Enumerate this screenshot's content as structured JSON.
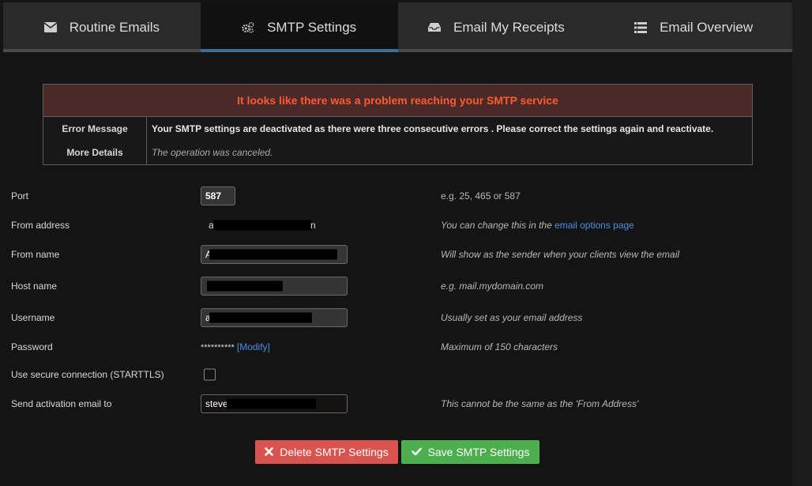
{
  "tabs": [
    {
      "label": "Routine Emails",
      "icon": "envelope-icon"
    },
    {
      "label": "SMTP Settings",
      "icon": "gears-icon"
    },
    {
      "label": "Email My Receipts",
      "icon": "inbox-icon"
    },
    {
      "label": "Email Overview",
      "icon": "list-icon"
    }
  ],
  "error": {
    "title": "It looks like there was a problem reaching your SMTP service",
    "message_label": "Error Message",
    "message": "Your SMTP settings are deactivated as there were three consecutive errors . Please correct the settings again and reactivate.",
    "details_label": "More Details",
    "details": "The operation was canceled."
  },
  "form": {
    "port": {
      "label": "Port",
      "value": "587",
      "hint": "e.g. 25, 465 or 587"
    },
    "from_address": {
      "label": "From address",
      "value_start": "a",
      "value_end": "n",
      "hint_prefix": "You can change this in the",
      "hint_link": "email options page"
    },
    "from_name": {
      "label": "From name",
      "value": "A",
      "hint": "Will show as the sender when your clients view the email"
    },
    "host_name": {
      "label": "Host name",
      "value": "",
      "hint": "e.g. mail.mydomain.com"
    },
    "username": {
      "label": "Username",
      "value": "a",
      "hint": "Usually set as your email address"
    },
    "password": {
      "label": "Password",
      "masked": "**********",
      "modify_link": "[Modify]",
      "hint": "Maximum of 150 characters"
    },
    "secure": {
      "label": "Use secure connection (STARTTLS)",
      "checked": false
    },
    "activation": {
      "label": "Send activation email to",
      "value": "steve",
      "hint": "This cannot be the same as the 'From Address'"
    }
  },
  "buttons": {
    "delete": "Delete SMTP Settings",
    "save": "Save SMTP Settings"
  },
  "colors": {
    "accent": "#3d6d9a",
    "error_text": "#ff5a2e",
    "delete": "#d9534f",
    "save": "#4cae4c",
    "link": "#4a90e2"
  }
}
